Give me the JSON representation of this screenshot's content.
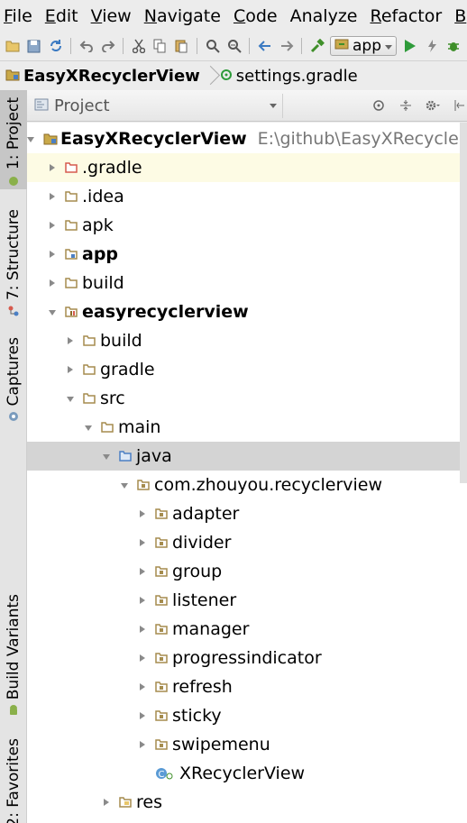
{
  "menu": {
    "items": [
      {
        "mnemonic": "F",
        "rest": "ile"
      },
      {
        "mnemonic": "E",
        "rest": "dit"
      },
      {
        "mnemonic": "V",
        "rest": "iew"
      },
      {
        "mnemonic": "N",
        "rest": "avigate"
      },
      {
        "mnemonic": "C",
        "rest": "ode"
      },
      {
        "mnemonic": "",
        "rest": "Analyze"
      },
      {
        "mnemonic": "R",
        "rest": "efactor"
      },
      {
        "mnemonic": "B",
        "rest": "u"
      }
    ]
  },
  "toolbar": {
    "run_config": "app",
    "icons": [
      "open-icon",
      "save-icon",
      "sync-icon",
      "undo-icon",
      "redo-icon",
      "cut-icon",
      "copy-icon",
      "paste-icon",
      "find-icon",
      "replace-icon",
      "back-icon",
      "forward-icon",
      "build-icon",
      "run-config-icon",
      "run-icon",
      "debug-icon",
      "attach-icon"
    ]
  },
  "breadcrumbs": {
    "project": "EasyXRecyclerView",
    "file": "settings.gradle"
  },
  "stripe": {
    "project_tab": "1: Project",
    "structure_tab": "7: Structure",
    "captures_tab": "Captures",
    "build_variants_tab": "Build Variants",
    "favorites_tab": "2: Favorites"
  },
  "panel": {
    "view_mode": "Project"
  },
  "tree": {
    "root_label": "EasyXRecyclerView",
    "root_path": "E:\\github\\EasyXRecyclerV",
    "nodes": [
      {
        "label": ".gradle",
        "bold": false
      },
      {
        "label": ".idea",
        "bold": false
      },
      {
        "label": "apk",
        "bold": false
      },
      {
        "label": "app",
        "bold": true
      },
      {
        "label": "build",
        "bold": false
      },
      {
        "label": "easyrecyclerview",
        "bold": true
      },
      {
        "label": "build",
        "bold": false
      },
      {
        "label": "gradle",
        "bold": false
      },
      {
        "label": "src",
        "bold": false
      },
      {
        "label": "main",
        "bold": false
      },
      {
        "label": "java",
        "bold": false
      },
      {
        "label": "com.zhouyou.recyclerview",
        "bold": false
      },
      {
        "label": "adapter",
        "bold": false
      },
      {
        "label": "divider",
        "bold": false
      },
      {
        "label": "group",
        "bold": false
      },
      {
        "label": "listener",
        "bold": false
      },
      {
        "label": "manager",
        "bold": false
      },
      {
        "label": "progressindicator",
        "bold": false
      },
      {
        "label": "refresh",
        "bold": false
      },
      {
        "label": "sticky",
        "bold": false
      },
      {
        "label": "swipemenu",
        "bold": false
      },
      {
        "label": "XRecyclerView",
        "bold": false
      },
      {
        "label": "res",
        "bold": false
      }
    ]
  },
  "colors": {
    "folder": "#a58c4e",
    "folder_red": "#d65a4e",
    "folder_blue": "#4b7fc4",
    "selected_row": "#d4d4d4",
    "highlight_row": "#fdfbe4",
    "run_green": "#2e9b3a"
  }
}
